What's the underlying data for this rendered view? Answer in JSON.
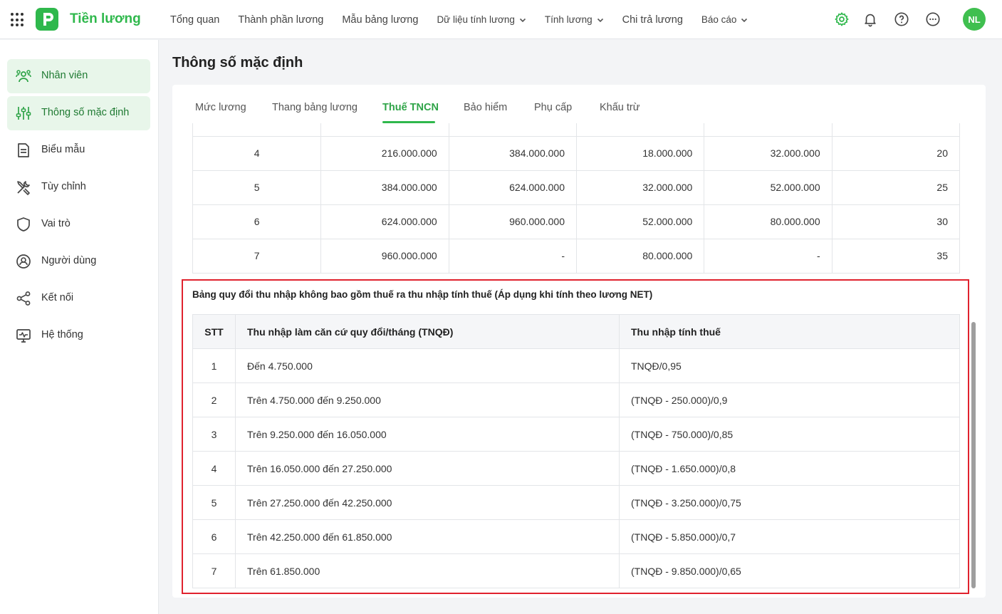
{
  "app": {
    "title": "Tiền lương",
    "logo_letter": "P",
    "avatar_initials": "NL",
    "brand_color": "#2fb84c"
  },
  "topnav": [
    {
      "label": "Tổng quan",
      "has_dropdown": false
    },
    {
      "label": "Thành phần lương",
      "has_dropdown": false
    },
    {
      "label": "Mẫu bảng lương",
      "has_dropdown": false
    },
    {
      "label": "Dữ liệu tính lương",
      "has_dropdown": true
    },
    {
      "label": "Tính lương",
      "has_dropdown": true
    },
    {
      "label": "Chi trả lương",
      "has_dropdown": false
    },
    {
      "label": "Báo cáo",
      "has_dropdown": true
    }
  ],
  "header_icons": [
    "gear-icon",
    "bell-icon",
    "help-icon",
    "more-icon"
  ],
  "sidebar": {
    "items": [
      {
        "label": "Nhân viên",
        "icon": "employees-icon",
        "active": true
      },
      {
        "label": "Thông số mặc định",
        "icon": "sliders-icon",
        "active": true
      },
      {
        "label": "Biểu mẫu",
        "icon": "document-icon",
        "active": false
      },
      {
        "label": "Tùy chỉnh",
        "icon": "tools-icon",
        "active": false
      },
      {
        "label": "Vai trò",
        "icon": "shield-icon",
        "active": false
      },
      {
        "label": "Người dùng",
        "icon": "user-circle-icon",
        "active": false
      },
      {
        "label": "Kết nối",
        "icon": "share-icon",
        "active": false
      },
      {
        "label": "Hệ thống",
        "icon": "monitor-pulse-icon",
        "active": false
      }
    ]
  },
  "page": {
    "title": "Thông số mặc định"
  },
  "tabs": [
    {
      "label": "Mức lương",
      "active": false
    },
    {
      "label": "Thang bảng lương",
      "active": false
    },
    {
      "label": "Thuế TNCN",
      "active": true
    },
    {
      "label": "Bảo hiểm",
      "active": false
    },
    {
      "label": "Phụ cấp",
      "active": false
    },
    {
      "label": "Khấu trừ",
      "active": false
    }
  ],
  "tax_table": {
    "rows": [
      [
        "4",
        "216.000.000",
        "384.000.000",
        "18.000.000",
        "32.000.000",
        "20"
      ],
      [
        "5",
        "384.000.000",
        "624.000.000",
        "32.000.000",
        "52.000.000",
        "25"
      ],
      [
        "6",
        "624.000.000",
        "960.000.000",
        "52.000.000",
        "80.000.000",
        "30"
      ],
      [
        "7",
        "960.000.000",
        "-",
        "80.000.000",
        "-",
        "35"
      ]
    ]
  },
  "conversion_table": {
    "caption": "Bảng quy đổi thu nhập không bao gồm thuế ra thu nhập tính thuế (Áp dụng khi tính theo lương NET)",
    "headers": [
      "STT",
      "Thu nhập làm căn cứ quy đổi/tháng (TNQĐ)",
      "Thu nhập tính thuế"
    ],
    "rows": [
      [
        "1",
        "Đến 4.750.000",
        "TNQĐ/0,95"
      ],
      [
        "2",
        "Trên 4.750.000 đến 9.250.000",
        "(TNQĐ - 250.000)/0,9"
      ],
      [
        "3",
        "Trên 9.250.000 đến 16.050.000",
        "(TNQĐ - 750.000)/0,85"
      ],
      [
        "4",
        "Trên 16.050.000 đến 27.250.000",
        "(TNQĐ - 1.650.000)/0,8"
      ],
      [
        "5",
        "Trên 27.250.000 đến 42.250.000",
        "(TNQĐ - 3.250.000)/0,75"
      ],
      [
        "6",
        "Trên 42.250.000 đến 61.850.000",
        "(TNQĐ - 5.850.000)/0,7"
      ],
      [
        "7",
        "Trên 61.850.000",
        "(TNQĐ - 9.850.000)/0,65"
      ]
    ]
  }
}
